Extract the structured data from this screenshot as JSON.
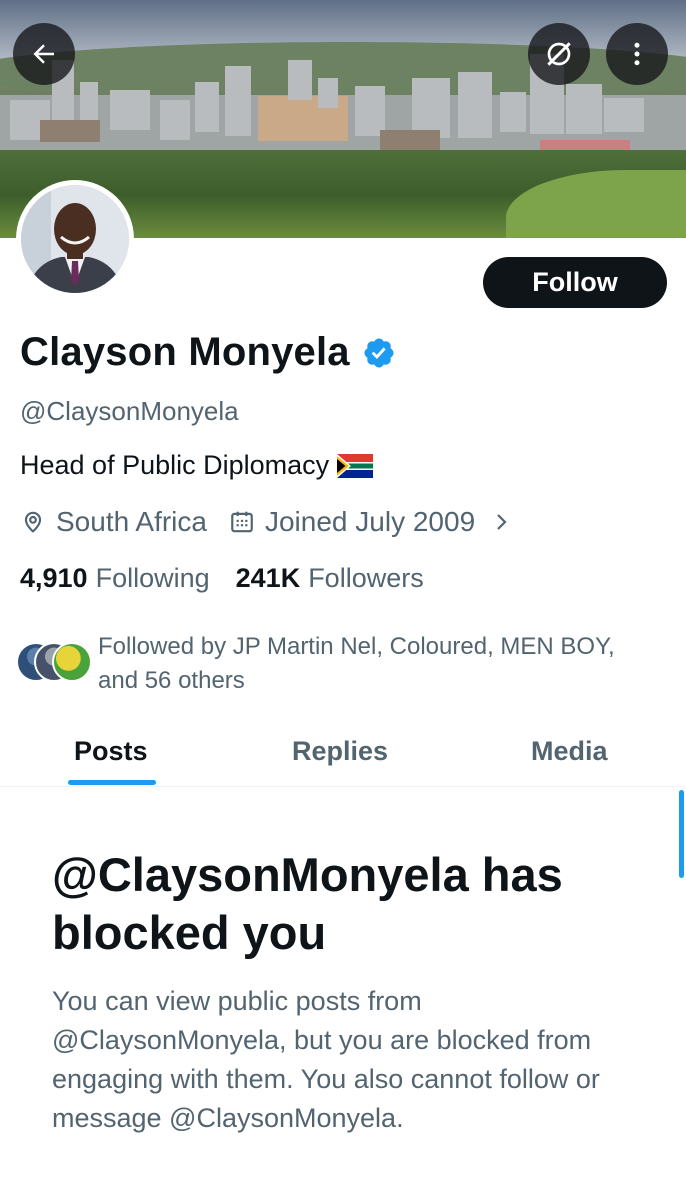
{
  "icons": {
    "back": "arrow-left-icon",
    "grok": "grok-icon",
    "more": "more-vertical-icon",
    "verified": "verified-badge-icon",
    "flag": "south-africa-flag",
    "location": "location-pin-icon",
    "calendar": "calendar-icon",
    "chevron": "chevron-right-icon"
  },
  "colors": {
    "accent": "#1d9bf0",
    "text_primary": "#0f1419",
    "text_secondary": "#536471",
    "follow_bg": "#0f1419"
  },
  "profile": {
    "follow_label": "Follow",
    "name": "Clayson Monyela",
    "handle": "@ClaysonMonyela",
    "bio": "Head of Public Diplomacy",
    "location": "South Africa",
    "joined": "Joined July 2009",
    "following_count": "4,910",
    "following_label": "Following",
    "followers_count": "241K",
    "followers_label": "Followers",
    "followed_by": "Followed by JP Martin Nel, Coloured, MEN BOY, and 56 others"
  },
  "tabs": [
    {
      "label": "Posts",
      "active": true
    },
    {
      "label": "Replies",
      "active": false
    },
    {
      "label": "Media",
      "active": false
    }
  ],
  "blocked": {
    "title": "@ClaysonMonyela has blocked you",
    "description": "You can view public posts from @ClaysonMonyela, but you are blocked from engaging with them. You also cannot follow or message @ClaysonMonyela."
  }
}
